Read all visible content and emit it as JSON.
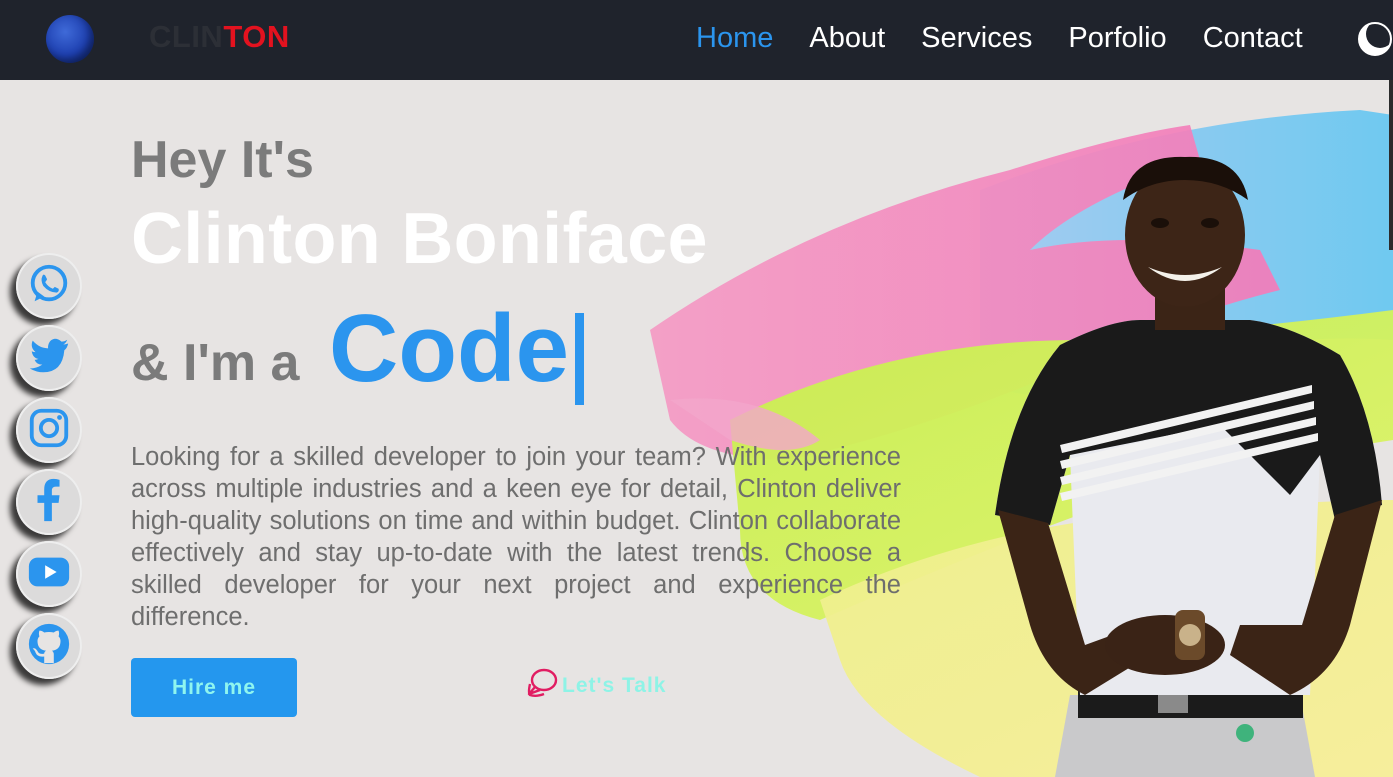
{
  "nav": {
    "brand_part1": "CLIN",
    "brand_part2": "TON",
    "links": [
      "Home",
      "About",
      "Services",
      "Porfolio",
      "Contact"
    ],
    "active": "Home"
  },
  "social": [
    "whatsapp-icon",
    "twitter-icon",
    "instagram-icon",
    "facebook-icon",
    "youtube-icon",
    "github-icon"
  ],
  "hero": {
    "greeting": "Hey It's",
    "name": "Clinton Boniface",
    "role_prefix": "& I'm a",
    "role": "Code",
    "bio": "Looking for a skilled developer to join your team? With experience across multiple industries and a keen eye for detail, Clinton deliver high-quality solutions on time and within budget. Clinton collaborate effectively and stay up-to-date with the latest trends. Choose a skilled developer for your next project and experience the difference.",
    "hire_label": "Hire me",
    "talk_label": "Let's Talk"
  },
  "colors": {
    "nav_bg": "#1f232c",
    "accent": "#2b95ee",
    "brand_red": "#e3121f",
    "page_bg": "#e7e4e3",
    "button_text": "#8ff5ef",
    "talk_icon": "#e11d62"
  }
}
